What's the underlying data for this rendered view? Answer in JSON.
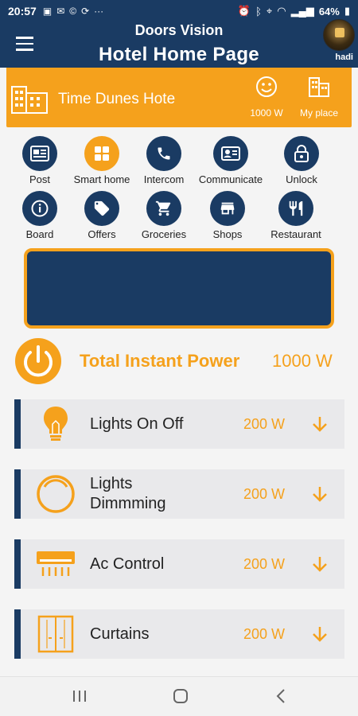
{
  "statusbar": {
    "time": "20:57",
    "battery": "64%"
  },
  "header": {
    "subtitle": "Doors Vision",
    "title": "Hotel Home Page",
    "username": "hadi"
  },
  "hotel": {
    "name": "Time Dunes Hote",
    "power_label": "1000 W",
    "myplace_label": "My place"
  },
  "services": [
    {
      "label": "Post",
      "icon": "post-icon"
    },
    {
      "label": "Smart home",
      "icon": "smart-home-icon"
    },
    {
      "label": "Intercom",
      "icon": "phone-icon"
    },
    {
      "label": "Communicate",
      "icon": "contact-card-icon"
    },
    {
      "label": "Unlock",
      "icon": "lock-icon"
    },
    {
      "label": "Board",
      "icon": "info-icon"
    },
    {
      "label": "Offers",
      "icon": "tag-icon"
    },
    {
      "label": "Groceries",
      "icon": "cart-icon"
    },
    {
      "label": "Shops",
      "icon": "store-icon"
    },
    {
      "label": "Restaurant",
      "icon": "restaurant-icon"
    }
  ],
  "total": {
    "label": "Total Instant Power",
    "value": "1000 W"
  },
  "devices": [
    {
      "name": "Lights On Off",
      "watts": "200 W",
      "icon": "bulb-icon"
    },
    {
      "name": "Lights Dimmming",
      "watts": "200 W",
      "icon": "dimmer-icon"
    },
    {
      "name": "Ac Control",
      "watts": "200 W",
      "icon": "ac-icon"
    },
    {
      "name": "Curtains",
      "watts": "200 W",
      "icon": "curtains-icon"
    }
  ],
  "colors": {
    "navy": "#1a3b63",
    "orange": "#f5a11c",
    "row_bg": "#e9e9eb"
  }
}
